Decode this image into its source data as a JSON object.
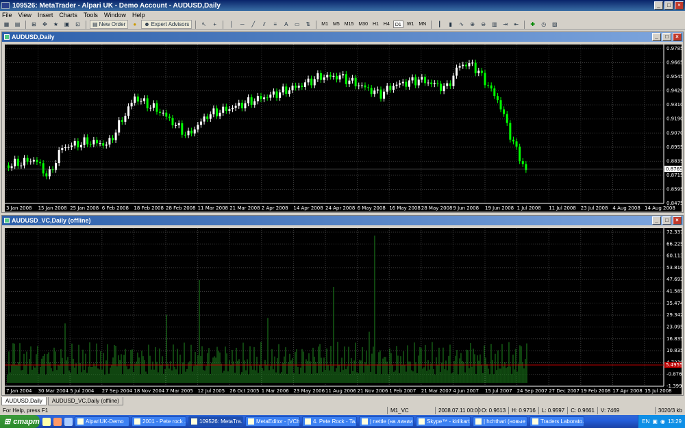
{
  "window": {
    "title": "109526: MetaTrader - Alpari UK - Demo Account - AUDUSD,Daily"
  },
  "menu": [
    "File",
    "View",
    "Insert",
    "Charts",
    "Tools",
    "Window",
    "Help"
  ],
  "toolbar": {
    "new_order": "New Order",
    "expert_advisors": "Expert Advisors",
    "text_tool": "A",
    "timeframes": [
      "M1",
      "M5",
      "M15",
      "M30",
      "H1",
      "H4",
      "D1",
      "W1",
      "MN"
    ],
    "active_timeframe": "D1"
  },
  "chart1": {
    "title": "AUDUSD,Daily",
    "price_labels": [
      "0.9785",
      "0.9665",
      "0.9545",
      "0.9420",
      "0.9310",
      "0.9190",
      "0.9070",
      "0.8955",
      "0.8835",
      "0.8715",
      "0.8595",
      "0.8475"
    ],
    "current_price": "0.8765",
    "date_labels": [
      "3 Jan 2008",
      "15 Jan 2008",
      "25 Jan 2008",
      "6 Feb 2008",
      "18 Feb 2008",
      "28 Feb 2008",
      "11 Mar 2008",
      "21 Mar 2008",
      "2 Apr 2008",
      "14 Apr 2008",
      "24 Apr 2008",
      "6 May 2008",
      "16 May 2008",
      "28 May 2008",
      "9 Jun 2008",
      "19 Jun 2008",
      "1 Jul 2008",
      "11 Jul 2008",
      "23 Jul 2008",
      "4 Aug 2008",
      "14 Aug 2008"
    ]
  },
  "chart2": {
    "title": "AUDUSD_VC,Daily (offline)",
    "price_labels": [
      "72.3370",
      "66.2250",
      "60.1130",
      "53.8100",
      "47.6930",
      "41.5850",
      "35.4740",
      "29.3420",
      "23.0950",
      "16.8350",
      "10.8350",
      "4.7230",
      "-0.8764",
      "-1.3990"
    ],
    "current_value": "5.4955",
    "date_labels": [
      "7 Jan 2004",
      "30 Mar 2004",
      "5 Jul 2004",
      "27 Sep 2004",
      "18 Nov 2004",
      "7 Mar 2005",
      "12 Jul 2005",
      "26 Oct 2005",
      "1 Mar 2006",
      "23 May 2006",
      "11 Aug 2006",
      "21 Nov 2006",
      "1 Feb 2007",
      "21 Mar 2007",
      "4 Jun 2007",
      "15 Jul 2007",
      "24 Sep 2007",
      "27 Dec 2007",
      "19 Feb 2008",
      "17 Apr 2008",
      "15 Jul 2008"
    ]
  },
  "tabs": [
    "AUDUSD,Daily",
    "AUDUSD_VC,Daily (offline)"
  ],
  "status": {
    "help": "For Help, press F1",
    "profile": "M1_VC",
    "datetime": "2008.07.11 00:00",
    "open": "O: 0.9613",
    "high": "H: 0.9716",
    "low": "L: 0.9597",
    "close": "C: 0.9661",
    "volume": "V: 7469",
    "traffic": "3020/3 kb"
  },
  "taskbar": {
    "start": "старт",
    "tasks": [
      "AlpariUK-Demo",
      "2001 - Pete rock ...",
      "109526: MetaTra...",
      "MetaEditor - [VCh...",
      "4. Pete Rock - Ta...",
      "| nettle (на линии...",
      "Skype™ - kirilkart...",
      "| hchthari (новые ...",
      "Traders Laborato..."
    ],
    "active_task": "109526: MetaTra...",
    "lang": "EN",
    "clock": "13:29"
  },
  "colors": {
    "bull": "#ffffff",
    "bear": "#00ff00",
    "vol": "#1f8a1f",
    "priceline": "#c00000",
    "grid": "#3a3a3a"
  }
}
